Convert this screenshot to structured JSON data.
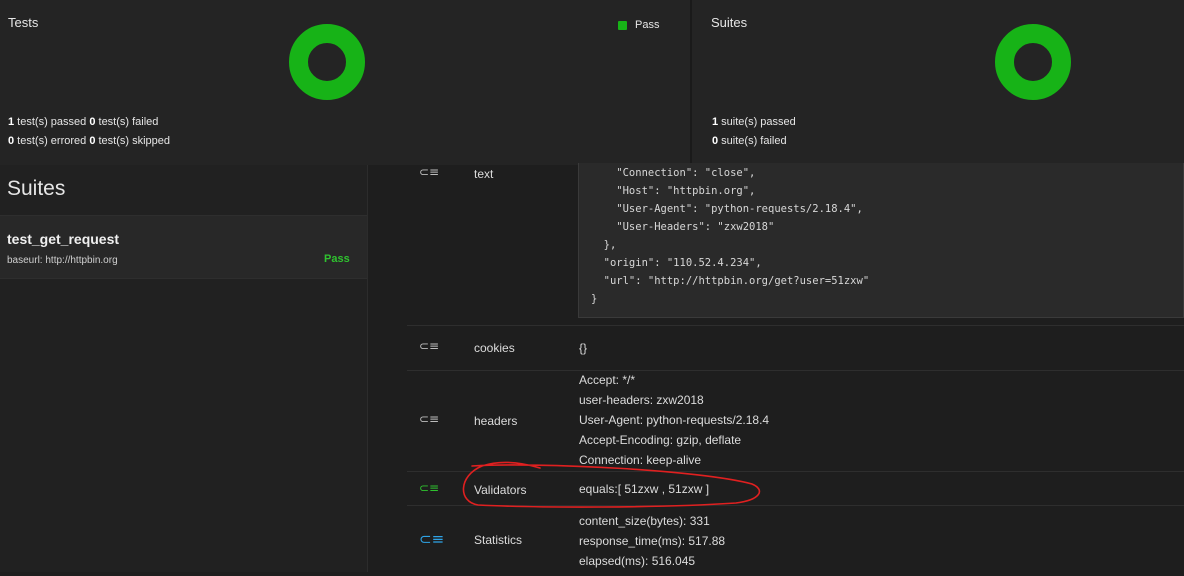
{
  "tests_panel": {
    "title": "Tests",
    "legend_label": "Pass",
    "passed_count": "1",
    "passed_text": " test(s) passed ",
    "failed_count": "0",
    "failed_text": " test(s) failed",
    "errored_count": "0",
    "errored_text": " test(s) errored ",
    "skipped_count": "0",
    "skipped_text": " test(s) skipped"
  },
  "suites_panel": {
    "title": "Suites",
    "passed_count": "1",
    "passed_text": " suite(s) passed",
    "failed_count": "0",
    "failed_text": " suite(s) failed"
  },
  "sidebar": {
    "title": "Suites",
    "items": [
      {
        "name": "test_get_request",
        "url": "baseurl: http://httpbin.org",
        "status": "Pass"
      }
    ]
  },
  "detail": {
    "text": {
      "key": "text",
      "lines": [
        "    \"Connection\": \"close\",",
        "    \"Host\": \"httpbin.org\",",
        "    \"User-Agent\": \"python-requests/2.18.4\",",
        "    \"User-Headers\": \"zxw2018\"",
        "  },",
        "  \"origin\": \"110.52.4.234\",",
        "  \"url\": \"http://httpbin.org/get?user=51zxw\"",
        "}"
      ]
    },
    "cookies": {
      "key": "cookies",
      "value": "{}"
    },
    "headers": {
      "key": "headers",
      "lines": [
        "Accept: */*",
        "user-headers: zxw2018",
        "User-Agent: python-requests/2.18.4",
        "Accept-Encoding: gzip, deflate",
        "Connection: keep-alive"
      ]
    },
    "validators": {
      "key": "Validators",
      "value": "equals:[ 51zxw , 51zxw ]"
    },
    "statistics": {
      "key": "Statistics",
      "lines": [
        "content_size(bytes): 331",
        "response_time(ms): 517.88",
        "elapsed(ms): 516.045"
      ]
    }
  },
  "colors": {
    "pass_green": "#17b317",
    "annotation_red": "#e02020",
    "stats_icon_blue": "#2ea3e6"
  },
  "icons": {
    "row_toggle": "collapse-list-icon"
  }
}
